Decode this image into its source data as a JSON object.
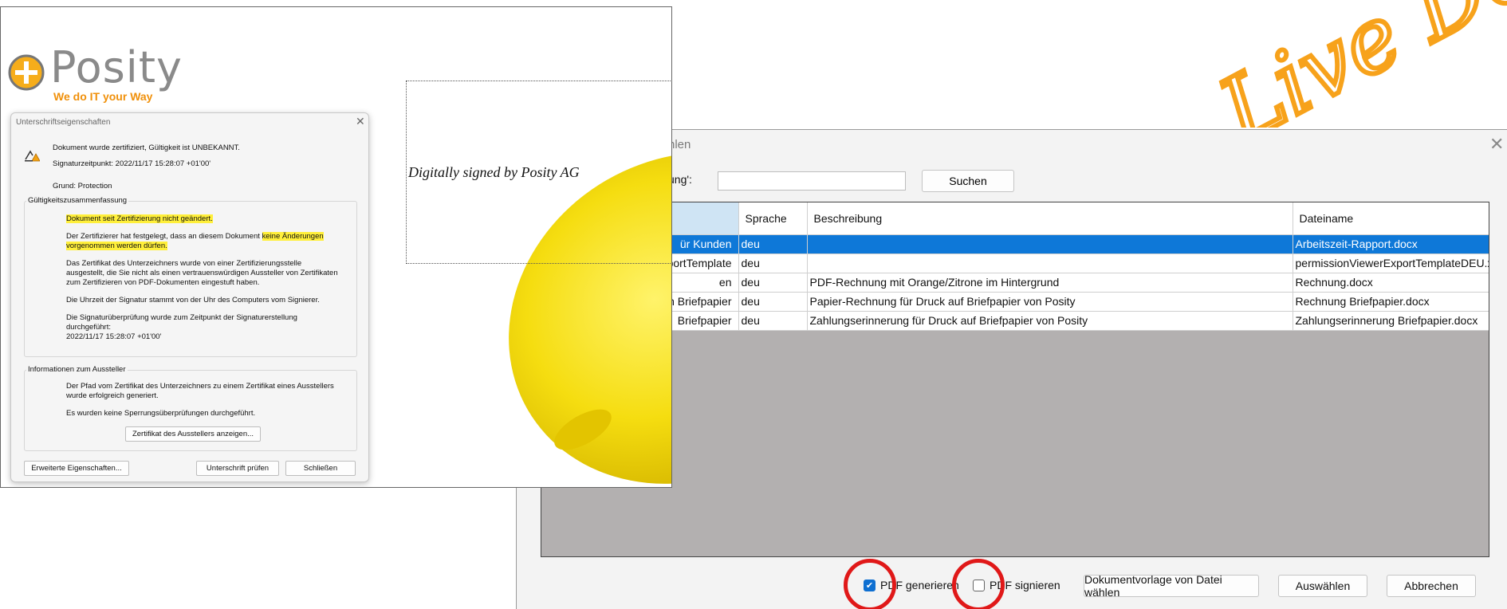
{
  "watermark": {
    "text": "Live De"
  },
  "template_dialog": {
    "title_fragment": "hlen",
    "search_label": "ung':",
    "search_value": "",
    "search_button": "Suchen",
    "columns": [
      "",
      "Sprache",
      "Beschreibung",
      "Dateiname"
    ],
    "rows": [
      {
        "name": "ür Kunden",
        "lang": "deu",
        "desc": "",
        "file": "Arbeitszeit-Rapport.docx",
        "selected": true
      },
      {
        "name": "portTemplate",
        "lang": "deu",
        "desc": "",
        "file": "permissionViewerExportTemplateDEU.xlsx",
        "selected": false
      },
      {
        "name": "en",
        "lang": "deu",
        "desc": "PDF-Rechnung mit Orange/Zitrone im Hintergrund",
        "file": "Rechnung.docx",
        "selected": false
      },
      {
        "name": "en Briefpapier",
        "lang": "deu",
        "desc": "Papier-Rechnung für Druck auf Briefpapier von Posity",
        "file": "Rechnung Briefpapier.docx",
        "selected": false
      },
      {
        "name": "Briefpapier",
        "lang": "deu",
        "desc": "Zahlungserinnerung für Druck auf Briefpapier von Posity",
        "file": "Zahlungserinnerung Briefpapier.docx",
        "selected": false
      }
    ],
    "pdf_generate": {
      "label": "PDF generieren",
      "checked": true
    },
    "pdf_sign": {
      "label": "PDF signieren",
      "checked": false
    },
    "choose_file_button": "Dokumentvorlage von Datei wählen",
    "select_button": "Auswählen",
    "cancel_button": "Abbrechen"
  },
  "pdf": {
    "logo_name": "Posity",
    "logo_tagline": "We do IT your Way",
    "signature_field": "Digitally signed by Posity AG"
  },
  "sig_props": {
    "title": "Unterschriftseigenschaften",
    "status": "Dokument wurde zertifiziert, Gültigkeit ist UNBEKANNT.",
    "timestamp": "Signaturzeitpunkt:  2022/11/17 15:28:07 +01'00'",
    "reason": "Grund:  Protection",
    "validity_group": "Gültigkeitszusammenfassung",
    "v1": "Dokument seit Zertifizierung nicht geändert.",
    "v2a": "Der Zertifizierer hat festgelegt, dass an diesem Dokument ",
    "v2b": "keine Änderungen",
    "v2c": "vorgenommen werden dürfen.",
    "v3a": "Das Zertifikat des Unterzeichners wurde von einer Zertifizierungsstelle",
    "v3b": "ausgestellt, die Sie nicht als einen vertrauenswürdigen Aussteller von Zertifikaten",
    "v3c": "zum Zertifizieren von PDF-Dokumenten eingestuft haben.",
    "v4": "Die Uhrzeit der Signatur stammt von der Uhr des Computers vom Signierer.",
    "v5a": "Die Signaturüberprüfung wurde zum Zeitpunkt der Signaturerstellung",
    "v5b": "durchgeführt:",
    "v5c": "2022/11/17 15:28:07 +01'00'",
    "issuer_group": "Informationen zum Aussteller",
    "i1a": "Der Pfad vom Zertifikat des Unterzeichners zu einem Zertifikat eines Ausstellers",
    "i1b": "wurde erfolgreich generiert.",
    "i2": "Es wurden keine Sperrungsüberprüfungen durchgeführt.",
    "show_cert_button": "Zertifikat des Ausstellers anzeigen...",
    "advanced_button": "Erweiterte Eigenschaften...",
    "verify_button": "Unterschrift prüfen",
    "close_button": "Schließen"
  }
}
